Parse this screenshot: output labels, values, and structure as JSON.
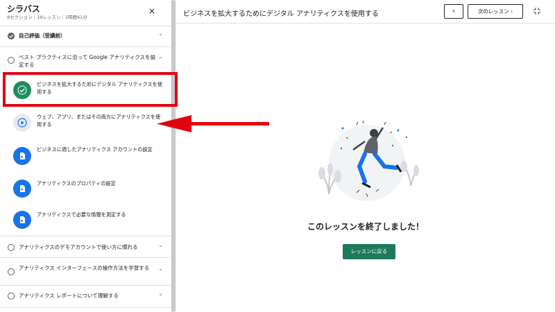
{
  "sidebar": {
    "title": "シラバス",
    "meta": "8セクション｜19レッスン｜1時間41分",
    "close_icon": "×",
    "sections_top": [
      {
        "label": "自己評価（受講前）",
        "state": "completed",
        "chevron": "⌄"
      },
      {
        "label": "ベスト プラクティスに沿って Google アナリティクスを設定する",
        "state": "open",
        "chevron": "⌃"
      }
    ],
    "lessons": [
      {
        "label": "ビジネスを拡大するためにデジタル アナリティクスを使用する",
        "type": "completed"
      },
      {
        "label": "ウェブ、アプリ、またはその両方にアナリティクスを使用する",
        "type": "video"
      },
      {
        "label": "ビジネスに適したアナリティクス アカウントの設定",
        "type": "document"
      },
      {
        "label": "アナリティクスのプロパティの設定",
        "type": "document"
      },
      {
        "label": "アナリティクスで必要な情報を測定する",
        "type": "document"
      }
    ],
    "sections_bottom": [
      {
        "label": "アナリティクスのデモアカウントで使い方に慣れる",
        "chevron": "⌄"
      },
      {
        "label": "アナリティクス インターフェースの操作方法を学習する",
        "chevron": "⌄"
      },
      {
        "label": "アナリティクス レポートについて理解する",
        "chevron": "⌄"
      }
    ]
  },
  "main": {
    "page_title": "ビジネスを拡大するためにデジタル アナリティクスを使用する",
    "prev_label": "‹",
    "next_label": "次のレッスン ›",
    "complete_message": "このレッスンを終了しました！",
    "return_button": "レッスンに戻る"
  },
  "colors": {
    "highlight": "#e3000f",
    "completed_icon": "#1e8e5e",
    "document_icon": "#1a73e8",
    "return_button": "#1f7a5c"
  }
}
